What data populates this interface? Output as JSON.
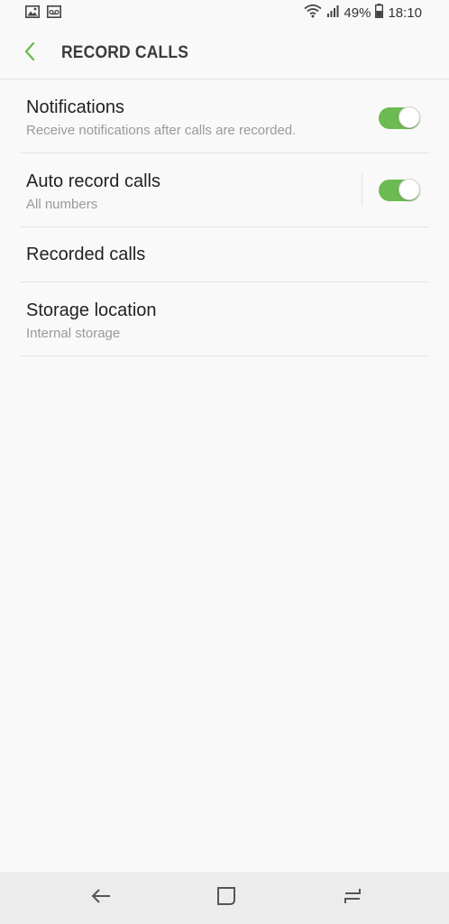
{
  "status_bar": {
    "left_icons": [
      "gallery-icon",
      "voicemail-icon"
    ],
    "battery_percent": "49%",
    "time": "18:10",
    "right_icons": [
      "wifi-icon",
      "signal-icon",
      "battery-icon"
    ]
  },
  "app_bar": {
    "title": "RECORD CALLS",
    "back_icon": "back-arrow-icon",
    "accent_color": "#6cbb52"
  },
  "settings": {
    "notifications": {
      "title": "Notifications",
      "subtitle": "Receive notifications after calls are recorded.",
      "enabled": true
    },
    "auto_record": {
      "title": "Auto record calls",
      "subtitle": "All numbers",
      "enabled": true
    },
    "recorded_calls": {
      "title": "Recorded calls"
    },
    "storage_location": {
      "title": "Storage location",
      "subtitle": "Internal storage"
    }
  },
  "nav_bar": {
    "buttons": [
      "back-icon",
      "home-icon",
      "recent-apps-icon"
    ]
  }
}
